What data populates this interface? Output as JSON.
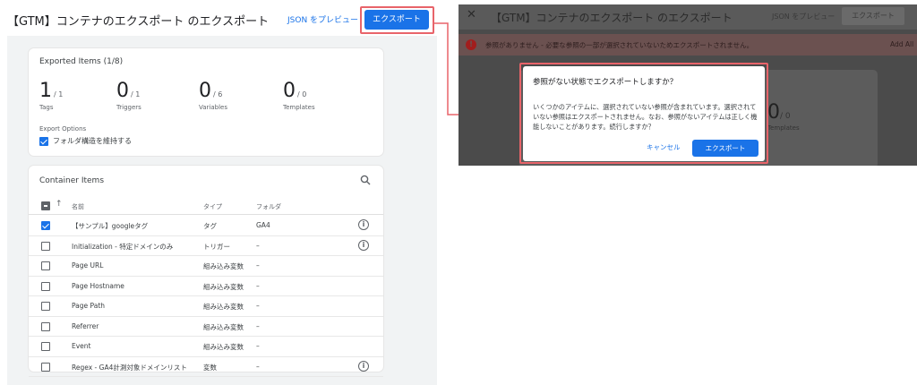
{
  "left": {
    "title": "【GTM】コンテナのエクスポート のエクスポート",
    "json_preview": "JSON をプレビュー",
    "export_button": "エクスポート",
    "exported": {
      "title": "Exported Items (1/8)",
      "stats": [
        {
          "value": "1",
          "total": "/ 1",
          "label": "Tags"
        },
        {
          "value": "0",
          "total": "/ 1",
          "label": "Triggers"
        },
        {
          "value": "0",
          "total": "/ 6",
          "label": "Variables"
        },
        {
          "value": "0",
          "total": "/ 0",
          "label": "Templates"
        }
      ],
      "options_title": "Export Options",
      "keep_folder_label": "フォルダ構造を維持する",
      "keep_folder_checked": true
    },
    "container": {
      "title": "Container Items",
      "search_icon": "search-icon",
      "headers": {
        "name": "名前",
        "type": "タイプ",
        "folder": "フォルダ"
      },
      "rows": [
        {
          "name": "【サンプル】googleタグ",
          "type": "タグ",
          "folder": "GA4",
          "checked": true,
          "info": true
        },
        {
          "name": "Initialization - 特定ドメインのみ",
          "type": "トリガー",
          "folder": "–",
          "checked": false,
          "info": true
        },
        {
          "name": "Page URL",
          "type": "組み込み変数",
          "folder": "–",
          "checked": false,
          "info": false
        },
        {
          "name": "Page Hostname",
          "type": "組み込み変数",
          "folder": "–",
          "checked": false,
          "info": false
        },
        {
          "name": "Page Path",
          "type": "組み込み変数",
          "folder": "–",
          "checked": false,
          "info": false
        },
        {
          "name": "Referrer",
          "type": "組み込み変数",
          "folder": "–",
          "checked": false,
          "info": false
        },
        {
          "name": "Event",
          "type": "組み込み変数",
          "folder": "–",
          "checked": false,
          "info": false
        },
        {
          "name": "Regex - GA4計測対象ドメインリスト",
          "type": "変数",
          "folder": "–",
          "checked": false,
          "info": true
        }
      ]
    }
  },
  "right": {
    "close": "✕",
    "title": "【GTM】コンテナのエクスポート のエクスポート",
    "json_preview": "JSON をプレビュー",
    "export_button": "エクスポート",
    "error_icon": "!",
    "error_text": "参照がありません - 必要な参照の一部が選択されていないためエクスポートされません。",
    "add_all": "Add All",
    "bg_value": "0",
    "bg_total": "/ 0",
    "bg_label": "Templates",
    "dialog": {
      "title": "参照がない状態でエクスポートしますか？",
      "body": "いくつかのアイテムに、選択されていない参照が含まれています。選択されていない参照はエクスポートされません。なお、参照がないアイテムは正しく機能しないことがあります。続行しますか？",
      "cancel": "キャンセル",
      "export": "エクスポート"
    }
  },
  "colors": {
    "accent": "#1a73e8",
    "highlight": "#e8646a",
    "error": "#a21d1d"
  }
}
